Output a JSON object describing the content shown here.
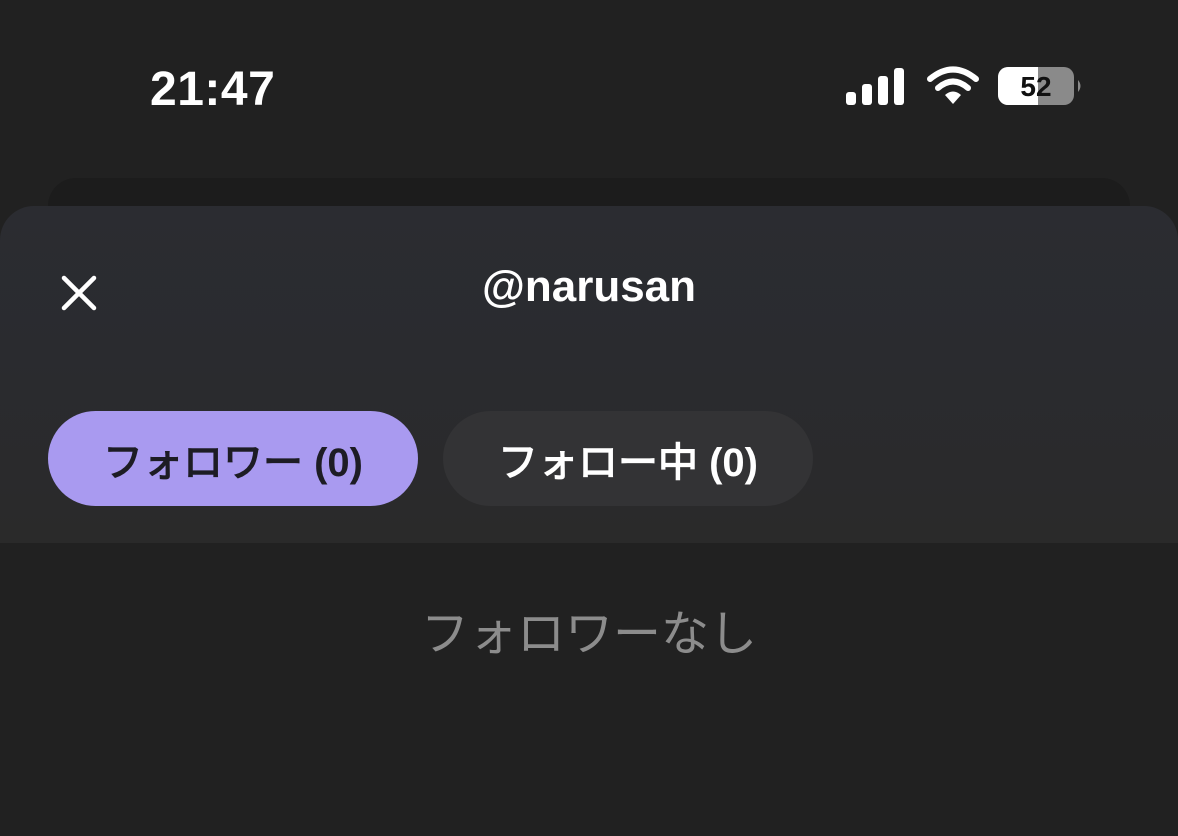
{
  "status_bar": {
    "time": "21:47",
    "battery_level": "52",
    "icons": [
      "cellular-signal-icon",
      "wifi-icon",
      "battery-icon"
    ]
  },
  "sheet": {
    "title": "@narusan",
    "close_icon": "close-icon",
    "tabs": [
      {
        "label": "フォロワー (0)",
        "selected": true
      },
      {
        "label": "フォロー中 (0)",
        "selected": false
      }
    ],
    "empty_message": "フォロワーなし"
  },
  "colors": {
    "background": "#212121",
    "sheet_header": "#2b2c31",
    "selected_tab": "#a99af0",
    "unselected_tab": "#333335",
    "empty_text": "#8c8c8c"
  }
}
